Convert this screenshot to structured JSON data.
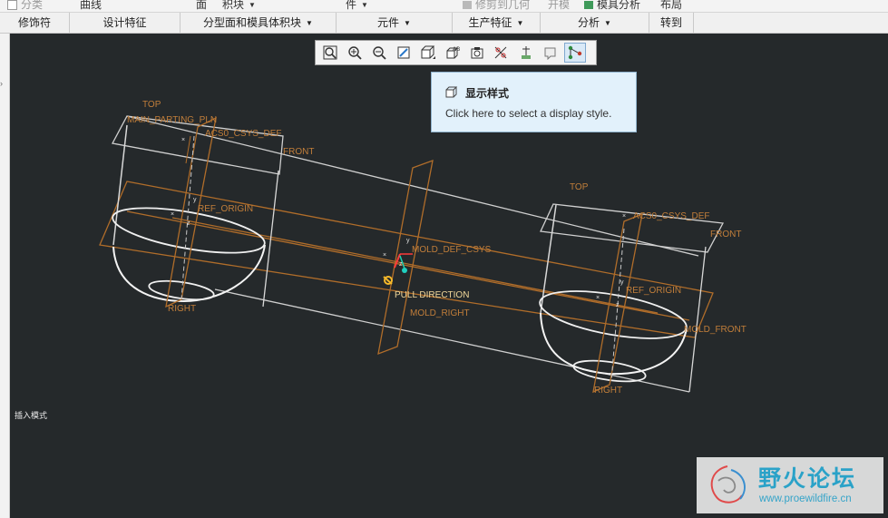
{
  "ribbon_top": {
    "items": [
      "分类",
      "曲线",
      "面",
      "积块",
      "件",
      "修剪到几何",
      "开模",
      "模具分析",
      "布局"
    ]
  },
  "ribbon_groups": [
    {
      "label": "修饰符",
      "dropdown": false
    },
    {
      "label": "设计特征",
      "dropdown": false
    },
    {
      "label": "分型面和模具体积块",
      "dropdown": true
    },
    {
      "label": "元件",
      "dropdown": true
    },
    {
      "label": "生产特征",
      "dropdown": true
    },
    {
      "label": "分析",
      "dropdown": true
    },
    {
      "label": "转到",
      "dropdown": false
    }
  ],
  "view_toolbar": {
    "buttons": [
      {
        "icon": "zoom-fit-icon"
      },
      {
        "icon": "zoom-in-icon"
      },
      {
        "icon": "zoom-out-icon"
      },
      {
        "icon": "repaint-icon"
      },
      {
        "icon": "display-style-icon"
      },
      {
        "icon": "saved-views-icon"
      },
      {
        "icon": "view-manager-icon"
      },
      {
        "icon": "datum-display-icon"
      },
      {
        "icon": "spin-center-icon"
      },
      {
        "icon": "annotation-display-icon"
      },
      {
        "icon": "model-tree-icon",
        "active": true
      }
    ]
  },
  "tooltip": {
    "title": "显示样式",
    "body": "Click here to select a display style.",
    "icon": "cube-icon"
  },
  "scene_labels": {
    "top_left": "TOP",
    "main_parting": "MAIN_PARTING_PLN",
    "csys_left": "ACS0_CSYS_DEF",
    "front_left": "FRONT",
    "ref_origin_left": "REF_ORIGIN",
    "right_left": "RIGHT",
    "mold_def_csys": "MOLD_DEF_CSYS",
    "pull_direction": "PULL DIRECTION",
    "mold_right": "MOLD_RIGHT",
    "top_right": "TOP",
    "csys_right": "ACS0_CSYS_DEF",
    "front_right": "FRONT",
    "ref_origin_right": "REF_ORIGIN",
    "mold_front": "MOLD_FRONT",
    "right_right": "RIGHT"
  },
  "status_text": "插入模式",
  "watermark": {
    "title": "野火论坛",
    "url": "www.proewildfire.cn"
  },
  "colors": {
    "viewport_bg": "#25292b",
    "datum_plane": "#b06d2a",
    "geometry": "#ffffff",
    "tooltip_bg": "#e2f1fb",
    "watermark_text": "#2aa2c8"
  }
}
